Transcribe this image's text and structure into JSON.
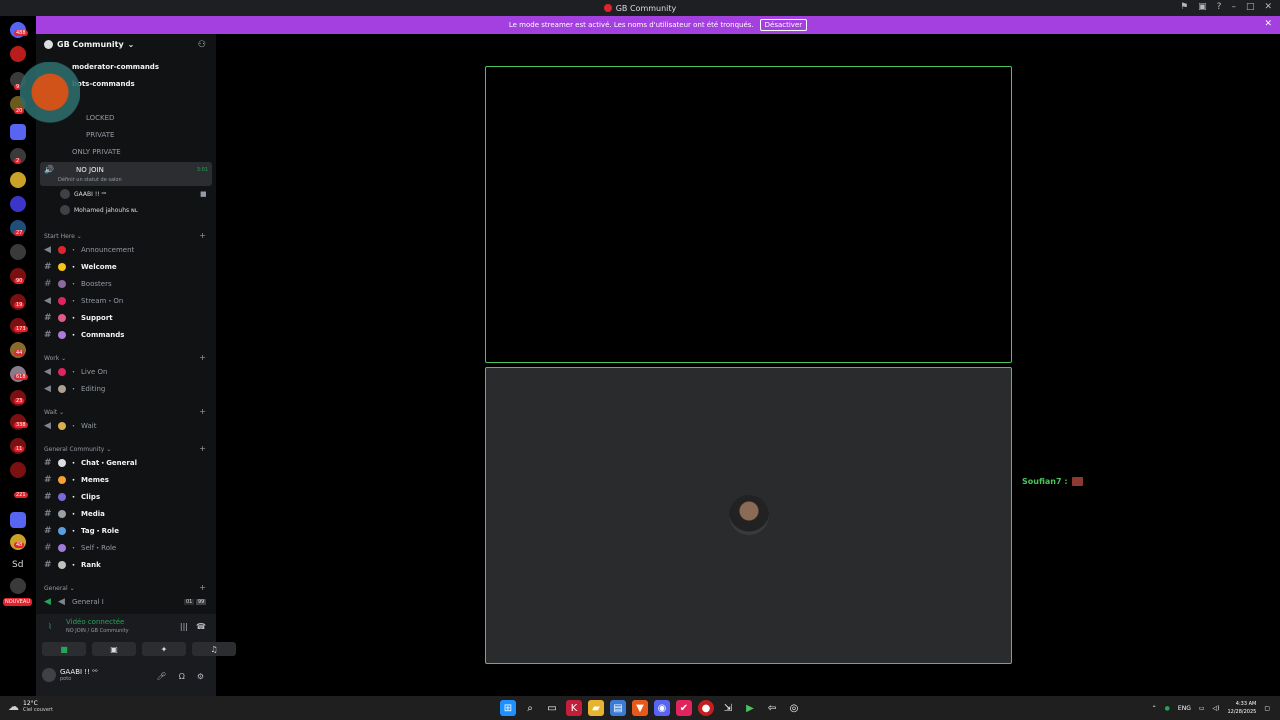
{
  "titlebar": {
    "title": "GB Community"
  },
  "banner": {
    "text": "Le mode streamer est activé. Les noms d'utilisateur ont été tronqués.",
    "button": "Désactiver"
  },
  "rail": {
    "badges": [
      "488",
      "9",
      "20",
      "2",
      "27",
      "90",
      "19",
      "173",
      "44",
      "618",
      "23",
      "338",
      "11",
      "221",
      "48"
    ],
    "sd_label": "Sd",
    "nouveau": "NOUVEAU"
  },
  "server": {
    "name": "GB Community"
  },
  "channels_top": [
    {
      "label": "moderator-commands"
    },
    {
      "label": "bots-commands"
    },
    {
      "label": "LOCKED"
    },
    {
      "label": "PRIVATE"
    },
    {
      "label": "ONLY PRIVATE"
    }
  ],
  "active_voice": {
    "name": "NO JOIN",
    "status": "Définir un statut de salon",
    "time": "3:01"
  },
  "voice_users": [
    {
      "name": "GAABI !! ᵒᵒ"
    },
    {
      "name": "Mohamed jahouhs ɴʟ"
    }
  ],
  "categories": {
    "start_here": "Start Here",
    "work": "Work",
    "wait": "Wait",
    "general_community": "General Community",
    "general": "General"
  },
  "start_here": [
    "Announcement",
    "Welcome",
    "Boosters",
    "Stream・On",
    "Support",
    "Commands"
  ],
  "work": [
    "Live On",
    "Editing"
  ],
  "wait": [
    "Wait"
  ],
  "general_community": [
    "Chat・General",
    "Memes",
    "Clips",
    "Media",
    "Tag・Role",
    "Self・Role",
    "Rank"
  ],
  "general": {
    "channel": "General I",
    "count": "01",
    "limit": "99"
  },
  "voice_panel": {
    "status": "Vidéo connectée",
    "sub": "NO JOIN / GB Community"
  },
  "user": {
    "name": "GAABI !! ᵒᵒ",
    "status": "poto"
  },
  "stage": {
    "speaker_label": "Soufian7 :"
  },
  "taskbar": {
    "temp": "12°C",
    "weather": "Ciel couvert",
    "lang": "ENG",
    "time": "4:33 AM",
    "date": "12/28/2025"
  },
  "colors": {
    "accent": "#a43fe0",
    "green": "#4ac45a",
    "red": "#e0242e"
  }
}
